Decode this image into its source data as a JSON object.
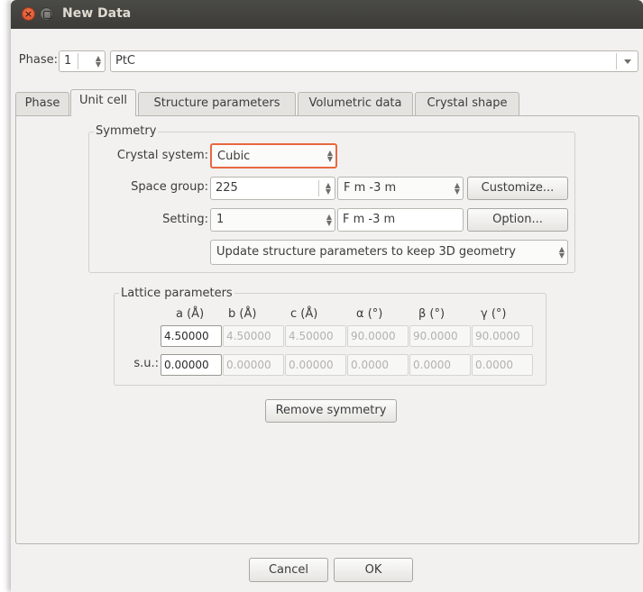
{
  "window": {
    "title": "New Data"
  },
  "phase": {
    "label": "Phase:",
    "number": "1",
    "name": "PtC"
  },
  "tabs": [
    "Phase",
    "Unit cell",
    "Structure parameters",
    "Volumetric data",
    "Crystal shape"
  ],
  "symmetry": {
    "group_label": "Symmetry",
    "crystal_system_label": "Crystal system:",
    "crystal_system_value": "Cubic",
    "space_group_label": "Space group:",
    "space_group_number": "225",
    "space_group_symbol": "F m -3 m",
    "customize_label": "Customize...",
    "setting_label": "Setting:",
    "setting_value": "1",
    "setting_symbol": "F m -3 m",
    "option_label": "Option...",
    "update_mode": "Update structure parameters to keep 3D geometry"
  },
  "lattice": {
    "group_label": "Lattice parameters",
    "headers": [
      "a (Å)",
      "b (Å)",
      "c (Å)",
      "α (°)",
      "β (°)",
      "γ (°)"
    ],
    "values": [
      "4.50000",
      "4.50000",
      "4.50000",
      "90.0000",
      "90.0000",
      "90.0000"
    ],
    "su_label": "s.u.:",
    "su_values": [
      "0.00000",
      "0.00000",
      "0.00000",
      "0.0000",
      "0.0000",
      "0.0000"
    ]
  },
  "remove_symmetry_label": "Remove symmetry",
  "footer": {
    "cancel_label": "Cancel",
    "ok_label": "OK"
  },
  "colors": {
    "focus_border": "#e9683f",
    "titlebar": "#3c3b37"
  }
}
